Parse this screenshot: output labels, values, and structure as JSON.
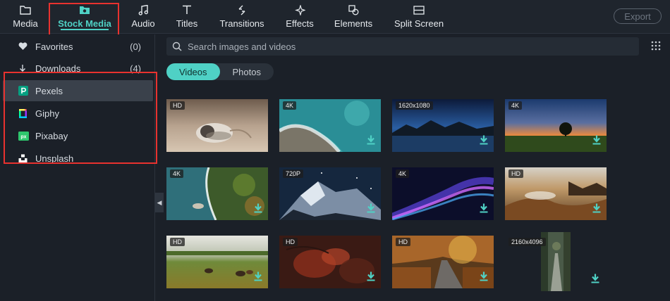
{
  "toolbar": {
    "items": [
      {
        "label": "Media"
      },
      {
        "label": "Stock Media"
      },
      {
        "label": "Audio"
      },
      {
        "label": "Titles"
      },
      {
        "label": "Transitions"
      },
      {
        "label": "Effects"
      },
      {
        "label": "Elements"
      },
      {
        "label": "Split Screen"
      }
    ],
    "export_label": "Export"
  },
  "sidebar": {
    "items": [
      {
        "label": "Favorites",
        "count": "(0)"
      },
      {
        "label": "Downloads",
        "count": "(4)"
      },
      {
        "label": "Pexels"
      },
      {
        "label": "Giphy"
      },
      {
        "label": "Pixabay"
      },
      {
        "label": "Unsplash"
      }
    ]
  },
  "search": {
    "placeholder": "Search images and videos"
  },
  "tabs": [
    {
      "label": "Videos"
    },
    {
      "label": "Photos"
    }
  ],
  "thumbnails": [
    {
      "badge": "HD"
    },
    {
      "badge": "4K"
    },
    {
      "badge": "1620x1080"
    },
    {
      "badge": "4K"
    },
    {
      "badge": "4K"
    },
    {
      "badge": "720P"
    },
    {
      "badge": "4K"
    },
    {
      "badge": "HD"
    },
    {
      "badge": "HD"
    },
    {
      "badge": "HD"
    },
    {
      "badge": "HD"
    },
    {
      "badge": "2160x4096"
    }
  ],
  "colors": {
    "accent": "#4fd1c5",
    "highlight_box": "#e8322f",
    "background": "#1b2028"
  }
}
